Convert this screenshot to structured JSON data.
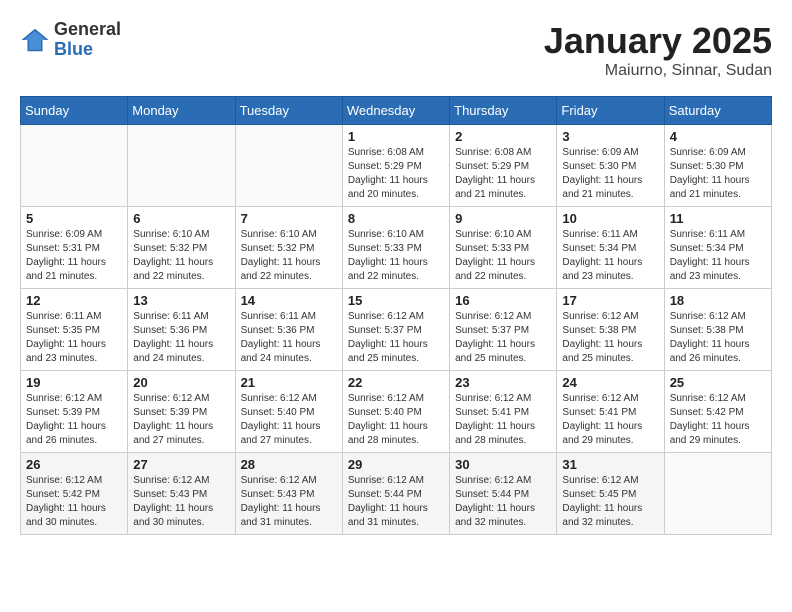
{
  "header": {
    "logo_general": "General",
    "logo_blue": "Blue",
    "month_title": "January 2025",
    "location": "Maiurno, Sinnar, Sudan"
  },
  "weekdays": [
    "Sunday",
    "Monday",
    "Tuesday",
    "Wednesday",
    "Thursday",
    "Friday",
    "Saturday"
  ],
  "weeks": [
    [
      {
        "day": "",
        "info": ""
      },
      {
        "day": "",
        "info": ""
      },
      {
        "day": "",
        "info": ""
      },
      {
        "day": "1",
        "info": "Sunrise: 6:08 AM\nSunset: 5:29 PM\nDaylight: 11 hours\nand 20 minutes."
      },
      {
        "day": "2",
        "info": "Sunrise: 6:08 AM\nSunset: 5:29 PM\nDaylight: 11 hours\nand 21 minutes."
      },
      {
        "day": "3",
        "info": "Sunrise: 6:09 AM\nSunset: 5:30 PM\nDaylight: 11 hours\nand 21 minutes."
      },
      {
        "day": "4",
        "info": "Sunrise: 6:09 AM\nSunset: 5:30 PM\nDaylight: 11 hours\nand 21 minutes."
      }
    ],
    [
      {
        "day": "5",
        "info": "Sunrise: 6:09 AM\nSunset: 5:31 PM\nDaylight: 11 hours\nand 21 minutes."
      },
      {
        "day": "6",
        "info": "Sunrise: 6:10 AM\nSunset: 5:32 PM\nDaylight: 11 hours\nand 22 minutes."
      },
      {
        "day": "7",
        "info": "Sunrise: 6:10 AM\nSunset: 5:32 PM\nDaylight: 11 hours\nand 22 minutes."
      },
      {
        "day": "8",
        "info": "Sunrise: 6:10 AM\nSunset: 5:33 PM\nDaylight: 11 hours\nand 22 minutes."
      },
      {
        "day": "9",
        "info": "Sunrise: 6:10 AM\nSunset: 5:33 PM\nDaylight: 11 hours\nand 22 minutes."
      },
      {
        "day": "10",
        "info": "Sunrise: 6:11 AM\nSunset: 5:34 PM\nDaylight: 11 hours\nand 23 minutes."
      },
      {
        "day": "11",
        "info": "Sunrise: 6:11 AM\nSunset: 5:34 PM\nDaylight: 11 hours\nand 23 minutes."
      }
    ],
    [
      {
        "day": "12",
        "info": "Sunrise: 6:11 AM\nSunset: 5:35 PM\nDaylight: 11 hours\nand 23 minutes."
      },
      {
        "day": "13",
        "info": "Sunrise: 6:11 AM\nSunset: 5:36 PM\nDaylight: 11 hours\nand 24 minutes."
      },
      {
        "day": "14",
        "info": "Sunrise: 6:11 AM\nSunset: 5:36 PM\nDaylight: 11 hours\nand 24 minutes."
      },
      {
        "day": "15",
        "info": "Sunrise: 6:12 AM\nSunset: 5:37 PM\nDaylight: 11 hours\nand 25 minutes."
      },
      {
        "day": "16",
        "info": "Sunrise: 6:12 AM\nSunset: 5:37 PM\nDaylight: 11 hours\nand 25 minutes."
      },
      {
        "day": "17",
        "info": "Sunrise: 6:12 AM\nSunset: 5:38 PM\nDaylight: 11 hours\nand 25 minutes."
      },
      {
        "day": "18",
        "info": "Sunrise: 6:12 AM\nSunset: 5:38 PM\nDaylight: 11 hours\nand 26 minutes."
      }
    ],
    [
      {
        "day": "19",
        "info": "Sunrise: 6:12 AM\nSunset: 5:39 PM\nDaylight: 11 hours\nand 26 minutes."
      },
      {
        "day": "20",
        "info": "Sunrise: 6:12 AM\nSunset: 5:39 PM\nDaylight: 11 hours\nand 27 minutes."
      },
      {
        "day": "21",
        "info": "Sunrise: 6:12 AM\nSunset: 5:40 PM\nDaylight: 11 hours\nand 27 minutes."
      },
      {
        "day": "22",
        "info": "Sunrise: 6:12 AM\nSunset: 5:40 PM\nDaylight: 11 hours\nand 28 minutes."
      },
      {
        "day": "23",
        "info": "Sunrise: 6:12 AM\nSunset: 5:41 PM\nDaylight: 11 hours\nand 28 minutes."
      },
      {
        "day": "24",
        "info": "Sunrise: 6:12 AM\nSunset: 5:41 PM\nDaylight: 11 hours\nand 29 minutes."
      },
      {
        "day": "25",
        "info": "Sunrise: 6:12 AM\nSunset: 5:42 PM\nDaylight: 11 hours\nand 29 minutes."
      }
    ],
    [
      {
        "day": "26",
        "info": "Sunrise: 6:12 AM\nSunset: 5:42 PM\nDaylight: 11 hours\nand 30 minutes."
      },
      {
        "day": "27",
        "info": "Sunrise: 6:12 AM\nSunset: 5:43 PM\nDaylight: 11 hours\nand 30 minutes."
      },
      {
        "day": "28",
        "info": "Sunrise: 6:12 AM\nSunset: 5:43 PM\nDaylight: 11 hours\nand 31 minutes."
      },
      {
        "day": "29",
        "info": "Sunrise: 6:12 AM\nSunset: 5:44 PM\nDaylight: 11 hours\nand 31 minutes."
      },
      {
        "day": "30",
        "info": "Sunrise: 6:12 AM\nSunset: 5:44 PM\nDaylight: 11 hours\nand 32 minutes."
      },
      {
        "day": "31",
        "info": "Sunrise: 6:12 AM\nSunset: 5:45 PM\nDaylight: 11 hours\nand 32 minutes."
      },
      {
        "day": "",
        "info": ""
      }
    ]
  ]
}
